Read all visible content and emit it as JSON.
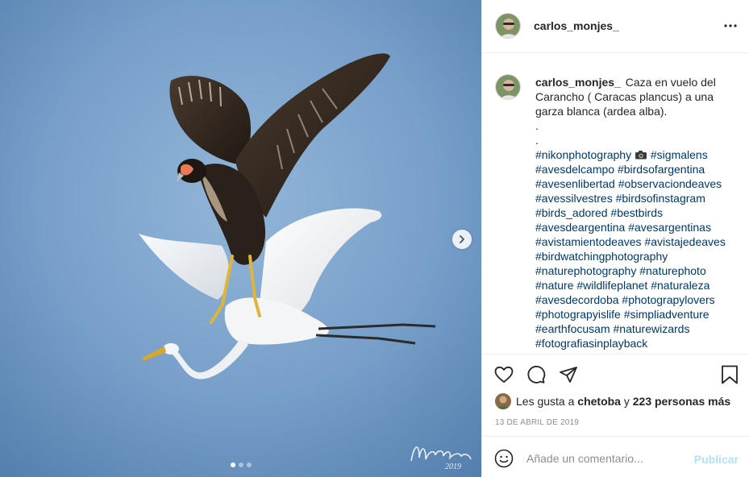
{
  "post": {
    "username": "carlos_monjes_",
    "caption_text": "Caza en vuelo del Carancho ( Caracas plancus) a una garza blanca (ardea alba).",
    "caption_dots": [
      ".",
      "."
    ],
    "first_tag": "#nikonphotography",
    "first_tag_emoji": "camera-emoji",
    "hashtags": [
      "#sigmalens",
      "#avesdelcampo",
      "#birdsofargentina",
      "#avesenlibertad",
      "#observaciondeaves",
      "#avessilvestres",
      "#birdsofinstagram",
      "#birds_adored",
      "#bestbirds",
      "#avesdeargentina",
      "#avesargentinas",
      "#avistamientodeaves",
      "#avistajedeaves",
      "#birdwatchingphotography",
      "#naturephotography",
      "#naturephoto",
      "#nature",
      "#wildlifeplanet",
      "#naturaleza",
      "#avesdecordoba",
      "#photograpylovers",
      "#photograpyislife",
      "#simpliadventure",
      "#earthfocusam",
      "#naturewizards",
      "#fotografiasinplayback"
    ],
    "likes": {
      "prefix": "Les gusta a",
      "user": "chetoba",
      "joiner": "y",
      "others": "223 personas más"
    },
    "date": "13 de abril de 2019",
    "comment": {
      "placeholder": "Añade un comentario...",
      "publish_label": "Publicar"
    },
    "media": {
      "slide_count": 3,
      "active_slide": 0,
      "watermark_text": "Monjes",
      "watermark_year": "2019"
    },
    "icons": {
      "more": "more-horizontal-icon",
      "next": "chevron-right-icon",
      "like": "heart-icon",
      "comment": "comment-icon",
      "share": "paper-plane-icon",
      "save": "bookmark-icon",
      "emoji": "smiley-icon"
    },
    "colors": {
      "hashtag": "#00376b",
      "publish_disabled": "#b2dffc",
      "meta_gray": "#8e8e8e",
      "text": "#262626"
    }
  }
}
